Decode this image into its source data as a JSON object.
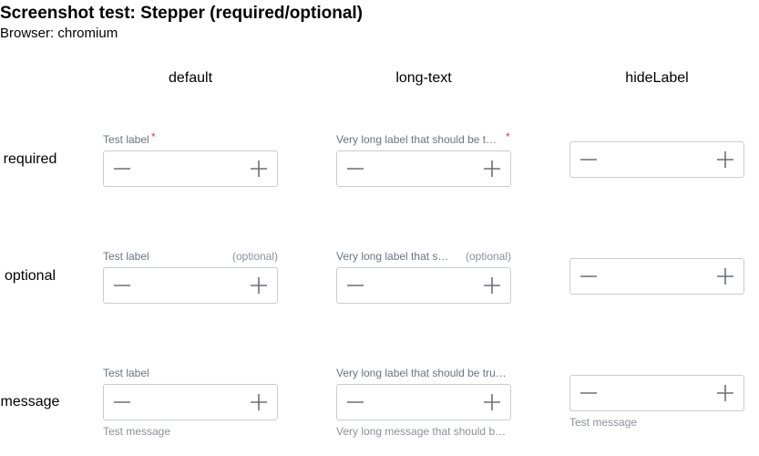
{
  "page": {
    "title": "Screenshot test: Stepper (required/optional)",
    "browser_line": "Browser: chromium"
  },
  "columns": [
    "default",
    "long-text",
    "hideLabel"
  ],
  "rows": [
    "required",
    "optional",
    "message"
  ],
  "colors": {
    "label": "#6b7280",
    "required_mark": "#d63b3b",
    "border": "#c9ccd1",
    "icon": "#6b6f76"
  },
  "icons": {
    "decrement": "minus-icon",
    "increment": "plus-icon"
  },
  "cells": {
    "required_default": {
      "label": "Test label",
      "required_mark": "*"
    },
    "required_longtext": {
      "label": "Very long label that should be t…",
      "required_mark": "*"
    },
    "optional_default": {
      "label": "Test label",
      "optional": "(optional)"
    },
    "optional_longtext": {
      "label": "Very long label that s…",
      "optional": "(optional)"
    },
    "message_default": {
      "label": "Test label",
      "message": "Test message"
    },
    "message_longtext": {
      "label": "Very long label that should be tru…",
      "message": "Very long message that should b…"
    },
    "message_hidelabel": {
      "message": "Test message"
    }
  }
}
